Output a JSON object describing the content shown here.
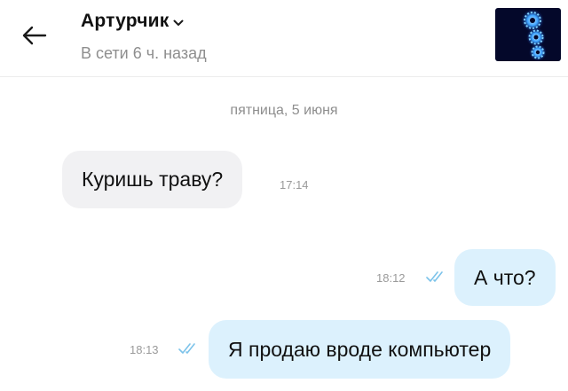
{
  "header": {
    "contact_name": "Артурчик",
    "status": "В сети 6 ч. назад",
    "icons": {
      "back": "arrow-left-icon",
      "dropdown": "chevron-down-icon"
    }
  },
  "chat": {
    "date_separator": "пятница, 5 июня",
    "messages": [
      {
        "direction": "incoming",
        "text": "Куришь траву?",
        "time": "17:14"
      },
      {
        "direction": "outgoing",
        "text": "А что?",
        "time": "18:12",
        "status": "read"
      },
      {
        "direction": "outgoing",
        "text": "Я продаю вроде компьютер",
        "time": "18:13",
        "status": "read"
      }
    ]
  },
  "colors": {
    "incoming_bubble": "#f1f1f3",
    "outgoing_bubble": "#dcf1fd",
    "read_check": "#7cc3ea",
    "secondary_text": "#8e8e8e"
  }
}
